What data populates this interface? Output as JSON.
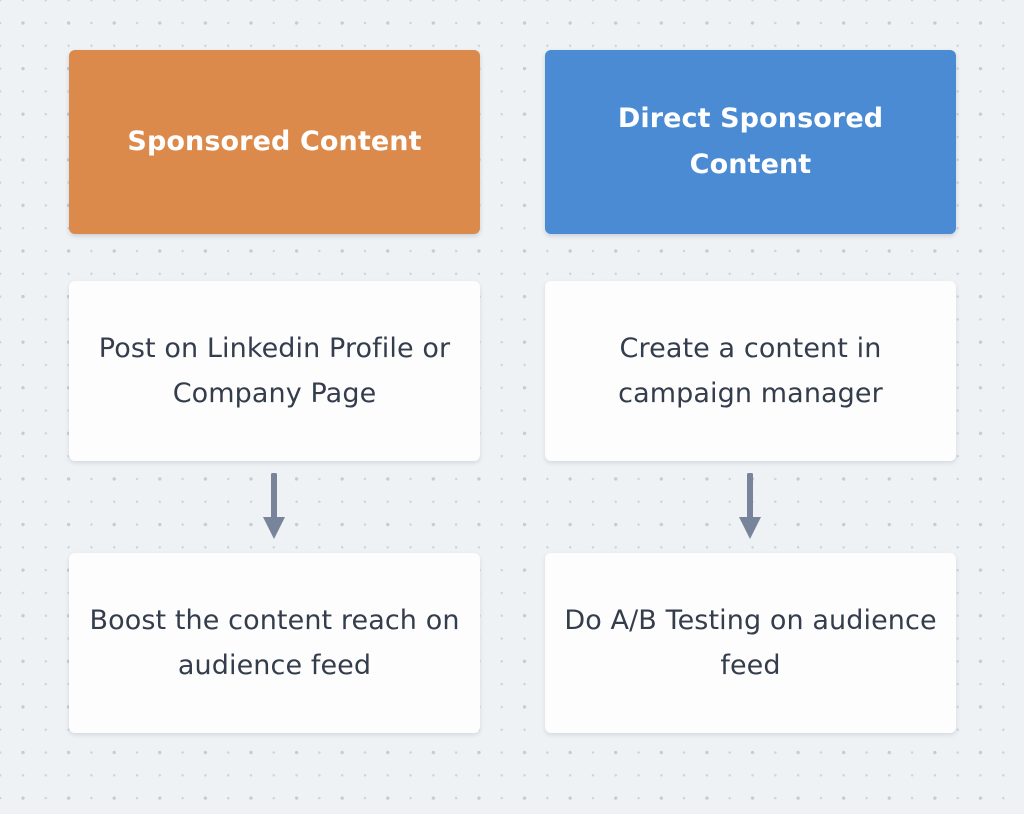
{
  "diagram": {
    "type": "two-column-flowchart",
    "background_color": "#eff2f5",
    "grid_dot_color": "#ccd3de",
    "columns": [
      {
        "id": "sponsored-content",
        "header": {
          "label": "Sponsored Content",
          "background_color": "#dc8a4b",
          "text_color": "#ffffff"
        },
        "steps": [
          {
            "label": "Post on Linkedin Profile or Company Page",
            "background_color": "#fdfdfd",
            "text_color": "#343d4c"
          },
          {
            "label": "Boost the content reach on audience feed",
            "background_color": "#fdfdfd",
            "text_color": "#343d4c"
          }
        ],
        "connector": {
          "icon": "arrow-down-icon",
          "color": "#78849a"
        }
      },
      {
        "id": "direct-sponsored-content",
        "header": {
          "label": "Direct Sponsored Content",
          "background_color": "#4a8bd4",
          "text_color": "#ffffff"
        },
        "steps": [
          {
            "label": "Create a content in campaign manager",
            "background_color": "#fdfdfd",
            "text_color": "#343d4c"
          },
          {
            "label": "Do A/B Testing on audience feed",
            "background_color": "#fdfdfd",
            "text_color": "#343d4c"
          }
        ],
        "connector": {
          "icon": "arrow-down-icon",
          "color": "#78849a"
        }
      }
    ]
  }
}
